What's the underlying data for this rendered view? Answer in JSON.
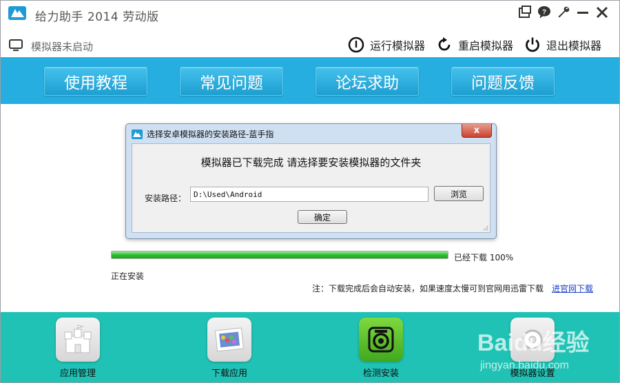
{
  "window": {
    "title": "给力助手 2014 劳动版"
  },
  "status": {
    "emulator_status": "模拟器未启动",
    "run_label": "运行模拟器",
    "restart_label": "重启模拟器",
    "exit_label": "退出模拟器"
  },
  "nav": {
    "items": [
      {
        "label": "使用教程"
      },
      {
        "label": "常见问题"
      },
      {
        "label": "论坛求助"
      },
      {
        "label": "问题反馈"
      }
    ]
  },
  "dialog": {
    "title": "选择安卓模拟器的安装路径-蓝手指",
    "close": "x",
    "message": "模拟器已下载完成 请选择要安装模拟器的文件夹",
    "path_label": "安装路径：",
    "path_value": "D:\\Used\\Android",
    "browse_label": "浏览",
    "ok_label": "确定"
  },
  "progress": {
    "percent": 100,
    "text": "已经下载 100%",
    "status": "正在安装",
    "note": "注：下载完成后会自动安装，如果速度太慢可到官网用迅雷下载",
    "link": "进官网下载"
  },
  "tools": [
    {
      "label": "应用管理",
      "icon": "castle-icon"
    },
    {
      "label": "下载应用",
      "icon": "photo-icon"
    },
    {
      "label": "检测安装",
      "icon": "camera-icon"
    },
    {
      "label": "模拟器设置",
      "icon": "settings-icon"
    }
  ],
  "watermark": {
    "text": "Baidu经验",
    "sub": "jingyan.baidu.com"
  },
  "colors": {
    "nav_band": "#27aee0",
    "bottom_band": "#1fc2b4",
    "progress_fill": "#2fbf2f",
    "link": "#1a3fc9"
  }
}
